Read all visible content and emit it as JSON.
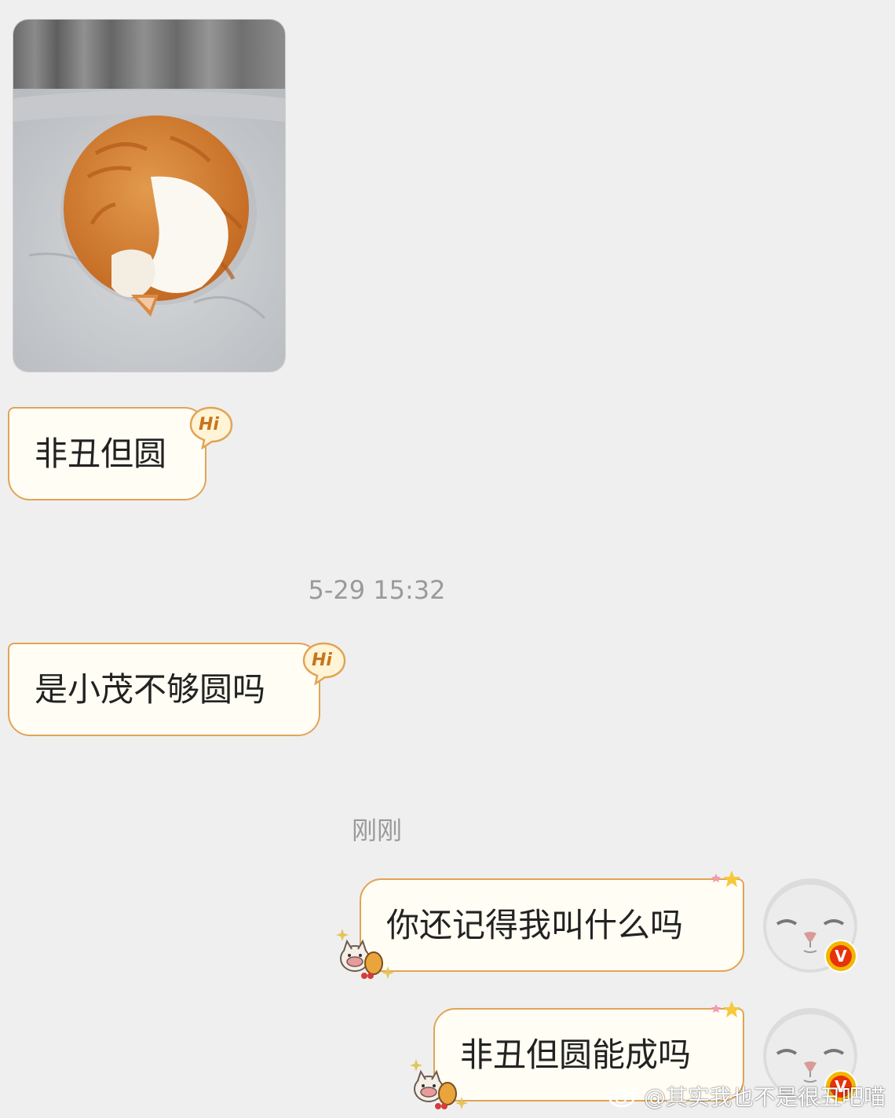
{
  "chat": {
    "messages": [
      {
        "side": "left",
        "type": "image",
        "image_icon": "sleeping-cat-photo"
      },
      {
        "side": "left",
        "type": "text",
        "text": "非丑但圆",
        "badge": "Hi"
      },
      {
        "type": "timestamp",
        "text": "5-29 15:32"
      },
      {
        "side": "left",
        "type": "text",
        "text": "是小茂不够圆吗",
        "badge": "Hi"
      },
      {
        "type": "timestamp",
        "text": "刚刚"
      },
      {
        "side": "right",
        "type": "text",
        "text": "你还记得我叫什么吗",
        "avatar_badge": "V"
      },
      {
        "side": "right",
        "type": "text",
        "text": "非丑但圆能成吗",
        "avatar_badge": "V"
      }
    ]
  },
  "watermark": {
    "text": "@其实我也不是很丑吧喵",
    "icon": "weibo-icon"
  },
  "colors": {
    "bubble_border": "#e1a457",
    "bubble_fill": "#fffdf4",
    "background": "#efefef"
  }
}
